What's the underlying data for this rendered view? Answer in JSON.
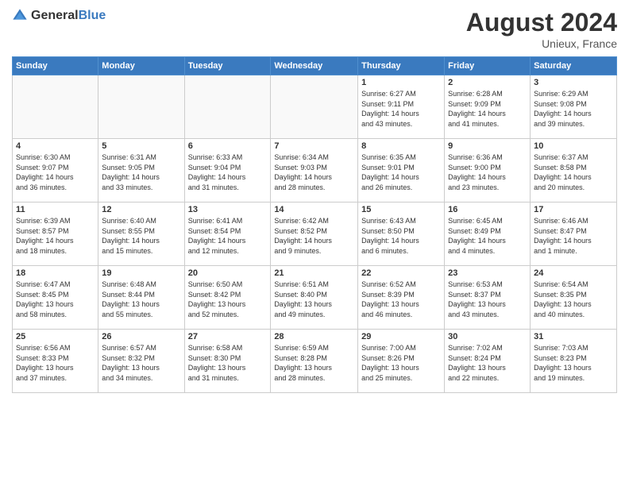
{
  "header": {
    "logo_general": "General",
    "logo_blue": "Blue",
    "month": "August 2024",
    "location": "Unieux, France"
  },
  "days_of_week": [
    "Sunday",
    "Monday",
    "Tuesday",
    "Wednesday",
    "Thursday",
    "Friday",
    "Saturday"
  ],
  "weeks": [
    [
      {
        "day": "",
        "info": ""
      },
      {
        "day": "",
        "info": ""
      },
      {
        "day": "",
        "info": ""
      },
      {
        "day": "",
        "info": ""
      },
      {
        "day": "1",
        "info": "Sunrise: 6:27 AM\nSunset: 9:11 PM\nDaylight: 14 hours\nand 43 minutes."
      },
      {
        "day": "2",
        "info": "Sunrise: 6:28 AM\nSunset: 9:09 PM\nDaylight: 14 hours\nand 41 minutes."
      },
      {
        "day": "3",
        "info": "Sunrise: 6:29 AM\nSunset: 9:08 PM\nDaylight: 14 hours\nand 39 minutes."
      }
    ],
    [
      {
        "day": "4",
        "info": "Sunrise: 6:30 AM\nSunset: 9:07 PM\nDaylight: 14 hours\nand 36 minutes."
      },
      {
        "day": "5",
        "info": "Sunrise: 6:31 AM\nSunset: 9:05 PM\nDaylight: 14 hours\nand 33 minutes."
      },
      {
        "day": "6",
        "info": "Sunrise: 6:33 AM\nSunset: 9:04 PM\nDaylight: 14 hours\nand 31 minutes."
      },
      {
        "day": "7",
        "info": "Sunrise: 6:34 AM\nSunset: 9:03 PM\nDaylight: 14 hours\nand 28 minutes."
      },
      {
        "day": "8",
        "info": "Sunrise: 6:35 AM\nSunset: 9:01 PM\nDaylight: 14 hours\nand 26 minutes."
      },
      {
        "day": "9",
        "info": "Sunrise: 6:36 AM\nSunset: 9:00 PM\nDaylight: 14 hours\nand 23 minutes."
      },
      {
        "day": "10",
        "info": "Sunrise: 6:37 AM\nSunset: 8:58 PM\nDaylight: 14 hours\nand 20 minutes."
      }
    ],
    [
      {
        "day": "11",
        "info": "Sunrise: 6:39 AM\nSunset: 8:57 PM\nDaylight: 14 hours\nand 18 minutes."
      },
      {
        "day": "12",
        "info": "Sunrise: 6:40 AM\nSunset: 8:55 PM\nDaylight: 14 hours\nand 15 minutes."
      },
      {
        "day": "13",
        "info": "Sunrise: 6:41 AM\nSunset: 8:54 PM\nDaylight: 14 hours\nand 12 minutes."
      },
      {
        "day": "14",
        "info": "Sunrise: 6:42 AM\nSunset: 8:52 PM\nDaylight: 14 hours\nand 9 minutes."
      },
      {
        "day": "15",
        "info": "Sunrise: 6:43 AM\nSunset: 8:50 PM\nDaylight: 14 hours\nand 6 minutes."
      },
      {
        "day": "16",
        "info": "Sunrise: 6:45 AM\nSunset: 8:49 PM\nDaylight: 14 hours\nand 4 minutes."
      },
      {
        "day": "17",
        "info": "Sunrise: 6:46 AM\nSunset: 8:47 PM\nDaylight: 14 hours\nand 1 minute."
      }
    ],
    [
      {
        "day": "18",
        "info": "Sunrise: 6:47 AM\nSunset: 8:45 PM\nDaylight: 13 hours\nand 58 minutes."
      },
      {
        "day": "19",
        "info": "Sunrise: 6:48 AM\nSunset: 8:44 PM\nDaylight: 13 hours\nand 55 minutes."
      },
      {
        "day": "20",
        "info": "Sunrise: 6:50 AM\nSunset: 8:42 PM\nDaylight: 13 hours\nand 52 minutes."
      },
      {
        "day": "21",
        "info": "Sunrise: 6:51 AM\nSunset: 8:40 PM\nDaylight: 13 hours\nand 49 minutes."
      },
      {
        "day": "22",
        "info": "Sunrise: 6:52 AM\nSunset: 8:39 PM\nDaylight: 13 hours\nand 46 minutes."
      },
      {
        "day": "23",
        "info": "Sunrise: 6:53 AM\nSunset: 8:37 PM\nDaylight: 13 hours\nand 43 minutes."
      },
      {
        "day": "24",
        "info": "Sunrise: 6:54 AM\nSunset: 8:35 PM\nDaylight: 13 hours\nand 40 minutes."
      }
    ],
    [
      {
        "day": "25",
        "info": "Sunrise: 6:56 AM\nSunset: 8:33 PM\nDaylight: 13 hours\nand 37 minutes."
      },
      {
        "day": "26",
        "info": "Sunrise: 6:57 AM\nSunset: 8:32 PM\nDaylight: 13 hours\nand 34 minutes."
      },
      {
        "day": "27",
        "info": "Sunrise: 6:58 AM\nSunset: 8:30 PM\nDaylight: 13 hours\nand 31 minutes."
      },
      {
        "day": "28",
        "info": "Sunrise: 6:59 AM\nSunset: 8:28 PM\nDaylight: 13 hours\nand 28 minutes."
      },
      {
        "day": "29",
        "info": "Sunrise: 7:00 AM\nSunset: 8:26 PM\nDaylight: 13 hours\nand 25 minutes."
      },
      {
        "day": "30",
        "info": "Sunrise: 7:02 AM\nSunset: 8:24 PM\nDaylight: 13 hours\nand 22 minutes."
      },
      {
        "day": "31",
        "info": "Sunrise: 7:03 AM\nSunset: 8:23 PM\nDaylight: 13 hours\nand 19 minutes."
      }
    ]
  ]
}
